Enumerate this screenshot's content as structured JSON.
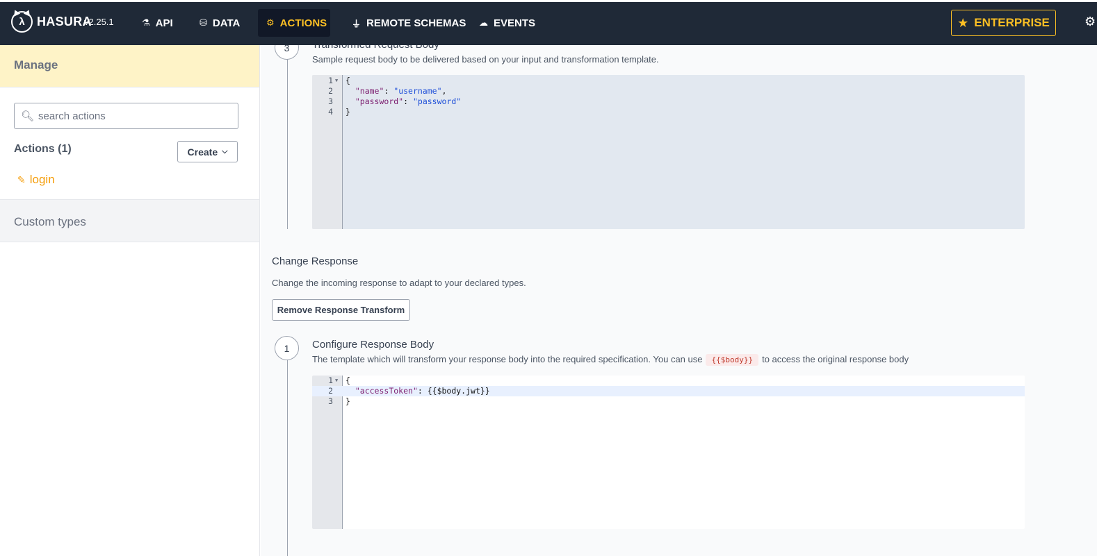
{
  "header": {
    "logo_text": "HASURA",
    "version": "v2.25.1",
    "nav": {
      "api": "API",
      "data": "DATA",
      "actions": "ACTIONS",
      "remote_schemas": "REMOTE SCHEMAS",
      "events": "EVENTS"
    },
    "enterprise": "ENTERPRISE",
    "active_tab": "ACTIONS",
    "accent_color": "#fbbf24"
  },
  "sidebar": {
    "manage": "Manage",
    "search_placeholder": "search actions",
    "actions_count": "Actions (1)",
    "create_label": "Create",
    "actions": [
      {
        "name": "login"
      }
    ],
    "custom_types": "Custom types"
  },
  "request_step": {
    "number": "3",
    "title": "Transformed Request Body",
    "description": "Sample request body to be delivered based on your input and transformation template.",
    "code": {
      "l1": "{",
      "l2_key": "\"name\"",
      "l2_sep": ": ",
      "l2_val": "\"username\"",
      "l2_end": ",",
      "l3_key": "\"password\"",
      "l3_sep": ": ",
      "l3_val": "\"password\"",
      "l4": "}"
    }
  },
  "change_response": {
    "title": "Change Response",
    "description": "Change the incoming response to adapt to your declared types.",
    "remove_label": "Remove Response Transform"
  },
  "response_step": {
    "number": "1",
    "title": "Configure Response Body",
    "description_before": "The template which will transform your response body into the required specification. You can use",
    "description_code": "{{$body}}",
    "description_after": "to access the original response body",
    "code": {
      "l1": "{",
      "l2_key": "\"accessToken\"",
      "l2_rest": ": {{$body.jwt}}",
      "l3": "}"
    }
  }
}
